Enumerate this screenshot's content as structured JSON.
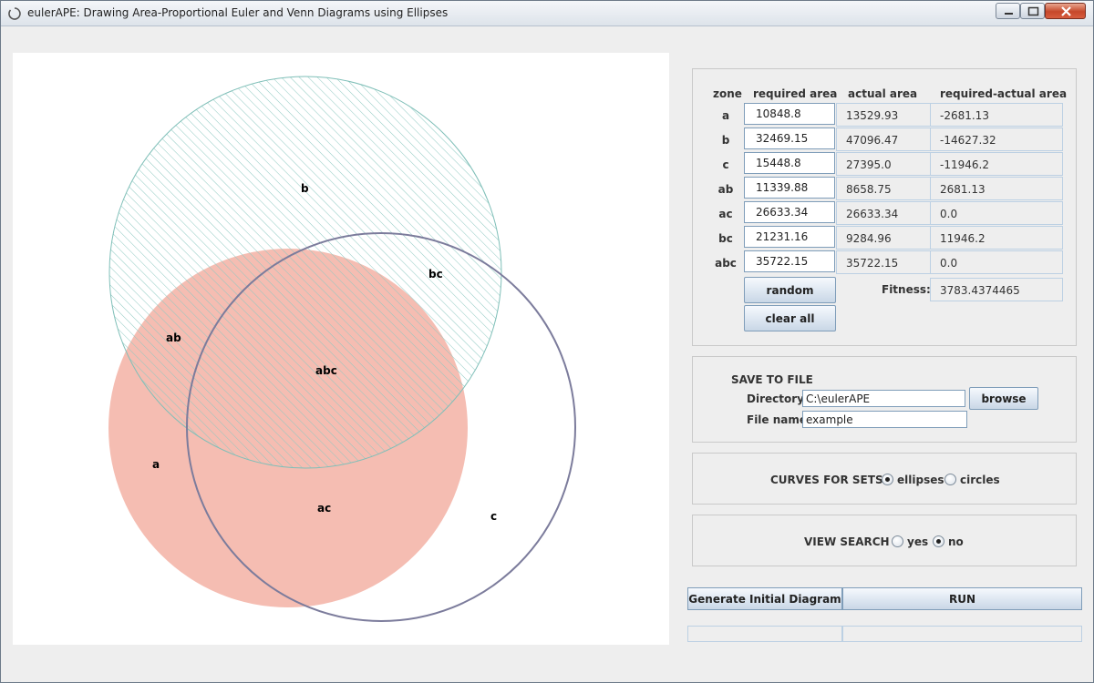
{
  "window": {
    "title": "eulerAPE: Drawing Area-Proportional Euler and Venn Diagrams using Ellipses"
  },
  "diagram": {
    "zone_labels": {
      "a": "a",
      "b": "b",
      "c": "c",
      "ab": "ab",
      "ac": "ac",
      "bc": "bc",
      "abc": "abc"
    },
    "colors": {
      "a_fill": "#f5bdb2",
      "b_stroke": "#7fbfb8",
      "b_hatch": "#8ec9c1",
      "c_stroke": "#7c7c9c"
    }
  },
  "table": {
    "headers": [
      "zone",
      "required area",
      "actual area",
      "required-actual area"
    ],
    "rows": [
      {
        "zone": "a",
        "required": "10848.8",
        "actual": "13529.93",
        "diff": "-2681.13"
      },
      {
        "zone": "b",
        "required": "32469.15",
        "actual": "47096.47",
        "diff": "-14627.32"
      },
      {
        "zone": "c",
        "required": "15448.8",
        "actual": "27395.0",
        "diff": "-11946.2"
      },
      {
        "zone": "ab",
        "required": "11339.88",
        "actual": "8658.75",
        "diff": "2681.13"
      },
      {
        "zone": "ac",
        "required": "26633.34",
        "actual": "26633.34",
        "diff": "0.0"
      },
      {
        "zone": "bc",
        "required": "21231.16",
        "actual": "9284.96",
        "diff": "11946.2"
      },
      {
        "zone": "abc",
        "required": "35722.15",
        "actual": "35722.15",
        "diff": "0.0"
      }
    ],
    "random_label": "random",
    "clear_label": "clear all",
    "fitness_label": "Fitness:",
    "fitness_value": "3783.4374465"
  },
  "save": {
    "title": "SAVE TO FILE",
    "directory_label": "Directory",
    "directory_value": "C:\\eulerAPE",
    "browse_label": "browse",
    "filename_label": "File name",
    "filename_value": "example"
  },
  "curves": {
    "label": "CURVES FOR SETS",
    "opt1": "ellipses",
    "opt2": "circles",
    "selected": "ellipses"
  },
  "view": {
    "label": "VIEW SEARCH",
    "opt1": "yes",
    "opt2": "no",
    "selected": "no"
  },
  "actions": {
    "generate_label": "Generate Initial Diagram",
    "run_label": "RUN"
  }
}
